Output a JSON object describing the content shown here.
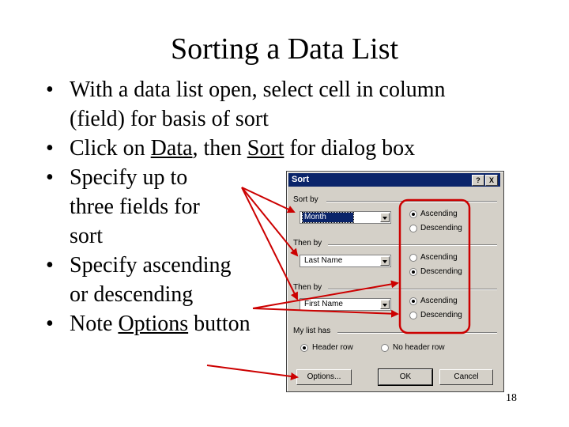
{
  "slide": {
    "title": "Sorting a Data List",
    "page_number": "18",
    "bullets": {
      "b1_line1": "With a data list open, select cell in column",
      "b1_line2": "(field) for basis of sort",
      "b2_pre": "Click on ",
      "b2_data": "Data",
      "b2_mid": ", then ",
      "b2_sort": "Sort",
      "b2_post": " for dialog box",
      "b3_line1": "Specify up to",
      "b3_line2": "three fields for",
      "b3_line3": "sort",
      "b4_line1": "Specify ascending",
      "b4_line2": "or descending",
      "b5_pre": "Note ",
      "b5_options": "Options",
      "b5_post": " button"
    },
    "bullet_glyph": "•",
    "arrow_color": "#cc0000"
  },
  "dialog": {
    "title": "Sort",
    "help_btn": "?",
    "close_btn": "X",
    "sort_by_label": "Sort by",
    "sort_by_value": "Month",
    "then_by_1_label": "Then by",
    "then_by_1_value": "Last Name",
    "then_by_2_label": "Then by",
    "then_by_2_value": "First Name",
    "ascending": "Ascending",
    "descending": "Descending",
    "group1_selected": "Ascending",
    "group2_selected": "Descending",
    "group3_selected": "Ascending",
    "my_list_has_label": "My list has",
    "header_row": "Header row",
    "no_header_row": "No header row",
    "header_selected": "Header row",
    "options_btn": "Options...",
    "ok_btn": "OK",
    "cancel_btn": "Cancel"
  }
}
